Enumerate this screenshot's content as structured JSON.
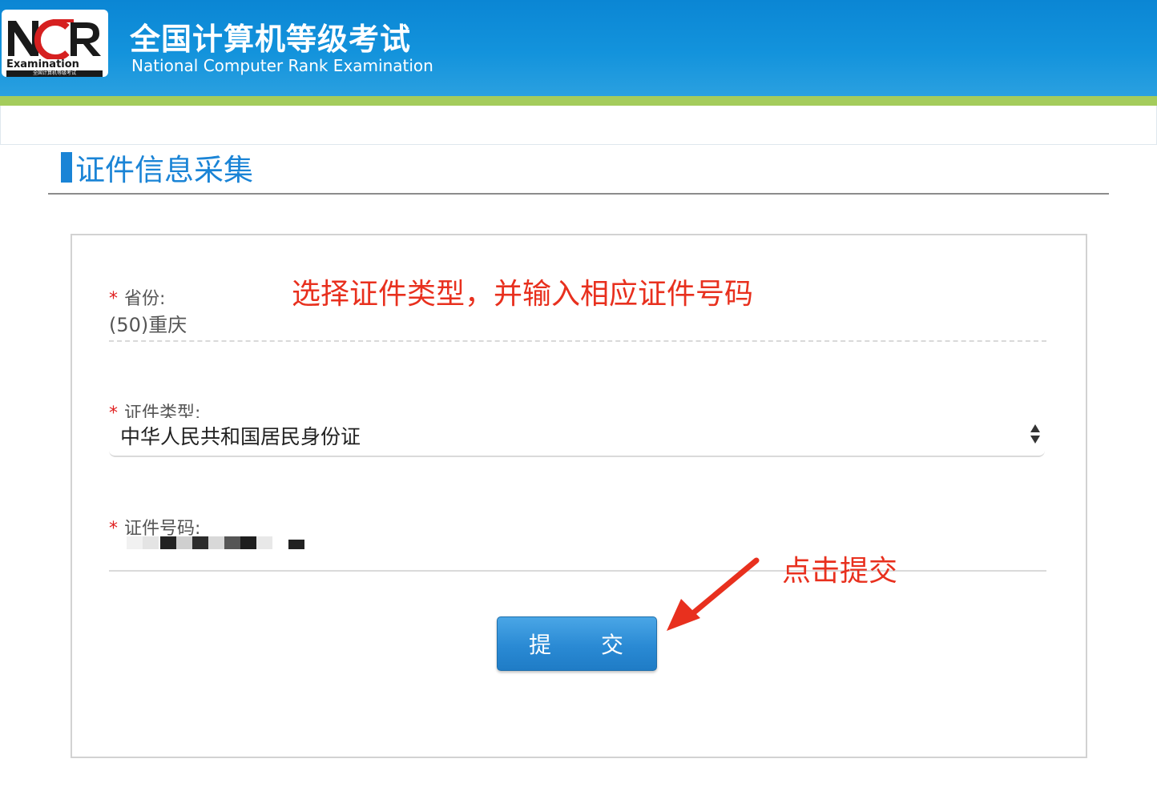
{
  "header": {
    "logo_text": "NCR",
    "logo_sub": "Examination",
    "logo_strip": "全国计算机等级考试",
    "title": "全国计算机等级考试",
    "subtitle": "National Computer Rank Examination"
  },
  "section": {
    "title": "证件信息采集"
  },
  "form": {
    "province": {
      "required_mark": "*",
      "label": "省份:",
      "value": "(50)重庆"
    },
    "id_type": {
      "required_mark": "*",
      "label": "证件类型:",
      "selected": "中华人民共和国居民身份证"
    },
    "id_number": {
      "required_mark": "*",
      "label": "证件号码:",
      "redacted": true
    },
    "submit_label": "提　　交"
  },
  "annotations": {
    "instruction": "选择证件类型，并输入相应证件号码",
    "submit_hint": "点击提交",
    "color": "#e8301e"
  },
  "colors": {
    "header_blue": "#1393dc",
    "accent_green": "#a4cc5c",
    "section_blue": "#1a84d6",
    "required_red": "#e02020"
  }
}
